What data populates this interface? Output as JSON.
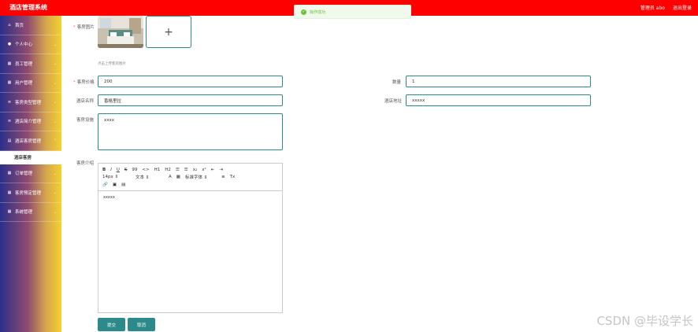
{
  "header": {
    "title": "酒店管理系统",
    "user_label": "管理员 abo",
    "logout_label": "退出登录"
  },
  "toast": {
    "message": "操作成功",
    "color": "#67c23a"
  },
  "sidebar": {
    "items": [
      {
        "label": "首页",
        "icon": "home-icon"
      },
      {
        "label": "个人中心",
        "icon": "user-icon"
      },
      {
        "label": "员工管理",
        "icon": "grid-icon"
      },
      {
        "label": "用户管理",
        "icon": "grid-icon"
      },
      {
        "label": "客房类型管理",
        "icon": "list-icon"
      },
      {
        "label": "酒店简介管理",
        "icon": "list-icon"
      },
      {
        "label": "酒店客房管理",
        "icon": "calendar-icon"
      }
    ],
    "active_sub": "酒店客房",
    "items_after": [
      {
        "label": "订单管理",
        "icon": "grid-icon"
      },
      {
        "label": "客房预定管理",
        "icon": "grid-icon"
      },
      {
        "label": "系统管理",
        "icon": "grid-icon"
      }
    ]
  },
  "form": {
    "image_label": "客房图片",
    "upload_hint": "点击上传客房图片",
    "price_label": "客房价格",
    "price_value": "200",
    "quantity_label": "数量",
    "quantity_value": "1",
    "hotel_name_label": "酒店名称",
    "hotel_name_value": "香格里拉",
    "hotel_address_label": "酒店地址",
    "hotel_address_value": "xxxxx",
    "facilities_label": "客房设施",
    "facilities_value": "xxxx",
    "intro_label": "客房介绍",
    "intro_value": "xxxxx",
    "submit_label": "提交",
    "cancel_label": "取消"
  },
  "editor_toolbar": {
    "row1": [
      "B",
      "I",
      "U",
      "S",
      "99",
      "<>",
      "H1",
      "H2",
      "☰",
      "☰",
      "x₂",
      "x²",
      "⇤",
      "⇥"
    ],
    "size": "14px",
    "block": "文本",
    "font": "标准字体",
    "row2_extra": [
      "A",
      "▦",
      "≡",
      "Tx"
    ],
    "row3": [
      "🔗",
      "▣",
      "▤"
    ]
  },
  "watermark": "CSDN @毕设学长"
}
